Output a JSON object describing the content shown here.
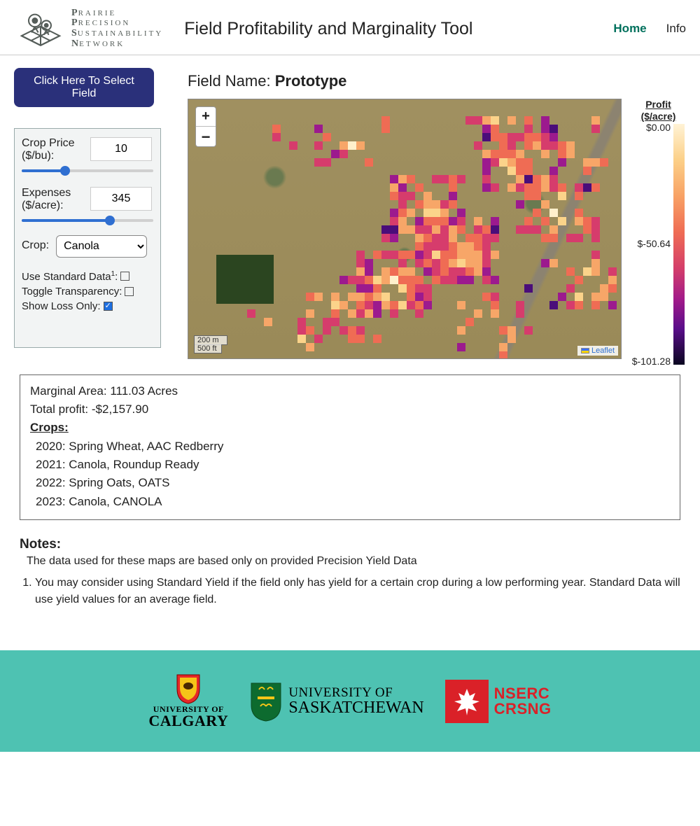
{
  "brand": {
    "l1": "Prairie",
    "l2": "Precision",
    "l3": "Sustainability",
    "l4": "Network"
  },
  "header": {
    "title": "Field Profitability and Marginality Tool",
    "nav": {
      "home": "Home",
      "info": "Info"
    }
  },
  "select_button": "Click Here To Select Field",
  "field_name": {
    "label": "Field Name:",
    "value": "Prototype"
  },
  "controls": {
    "price": {
      "label": "Crop Price ($/bu):",
      "value": "10",
      "slider_pct": 33
    },
    "expenses": {
      "label": "Expenses ($/acre):",
      "value": "345",
      "slider_pct": 67
    },
    "crop": {
      "label": "Crop:",
      "value": "Canola"
    },
    "use_standard": {
      "label_pre": "Use Standard Data",
      "sup": "1",
      "label_post": ":",
      "checked": false
    },
    "toggle_transparency": {
      "label": "Toggle Transparency:",
      "checked": false
    },
    "show_loss_only": {
      "label": "Show Loss Only:",
      "checked": true
    }
  },
  "map": {
    "zoom_in": "+",
    "zoom_out": "−",
    "scale_m": "200 m",
    "scale_ft": "500 ft",
    "attribution": "Leaflet"
  },
  "legend": {
    "title_l1": "Profit",
    "title_l2": "($/acre)",
    "v0": "$0.00",
    "v1": "$-50.64",
    "v2": "$-101.28"
  },
  "stats": {
    "marginal_area": "Marginal Area: 111.03 Acres",
    "total_profit": "Total profit: -$2,157.90",
    "crops_header": "Crops:",
    "crops": {
      "c0": "2020: Spring Wheat, AAC Redberry",
      "c1": "2021: Canola, Roundup Ready",
      "c2": "2022: Spring Oats, OATS",
      "c3": "2023: Canola, CANOLA"
    }
  },
  "notes": {
    "heading": "Notes:",
    "intro": "The data used for these maps are based only on provided Precision Yield Data",
    "item1": "You may consider using Standard Yield if the field only has yield for a certain crop during a low performing year. Standard Data will use yield values for an average field."
  },
  "footer": {
    "uc_l1": "UNIVERSITY OF",
    "uc_l2": "CALGARY",
    "us_l1": "UNIVERSITY OF",
    "us_l2": "SASKATCHEWAN",
    "nserc_l1": "NSERC",
    "nserc_l2": "CRSNG"
  }
}
